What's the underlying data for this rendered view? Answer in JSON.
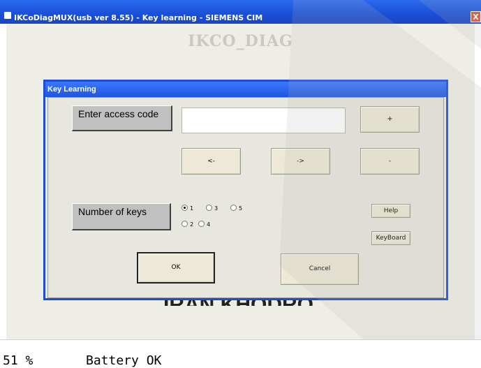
{
  "window": {
    "title": "IKCoDiagMUX(usb ver 8.55)  - Key learning - SIEMENS CIM",
    "close_label": "X"
  },
  "background": {
    "logo_text": "IKCO_DIAG",
    "partial_text": "IRAN KHODRO"
  },
  "dialog": {
    "title": "Key Learning",
    "access_code_label": "Enter access code",
    "access_code_value": "",
    "plus_label": "+",
    "left_label": "<-",
    "right_label": "->",
    "minus_label": "-",
    "num_keys_label": "Number of keys",
    "key_options": [
      "1",
      "2",
      "3",
      "4",
      "5"
    ],
    "key_selected": "1",
    "help_label": "Help",
    "keyboard_label": "KeyBoard",
    "ok_label": "OK",
    "cancel_label": "Cancel"
  },
  "status": {
    "percent": "51 %",
    "message": "Battery OK"
  },
  "colors": {
    "title_bar": "#1c55e0",
    "dialog_bg": "#e8e7df",
    "client_bg": "#efeee6"
  }
}
